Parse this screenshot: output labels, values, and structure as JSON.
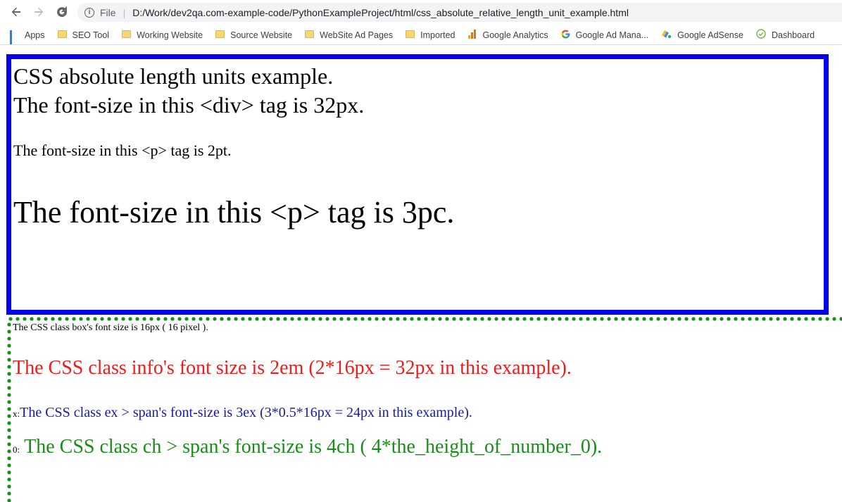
{
  "browser": {
    "url_scheme": "File",
    "url": "D:/Work/dev2qa.com-example-code/PythonExampleProject/html/css_absolute_relative_length_unit_example.html",
    "info_icon": "i"
  },
  "bookmarks": [
    {
      "label": "Apps",
      "icon": "apps-grid-icon"
    },
    {
      "label": "SEO Tool",
      "icon": "folder-icon"
    },
    {
      "label": "Working Website",
      "icon": "folder-icon"
    },
    {
      "label": "Source Website",
      "icon": "folder-icon"
    },
    {
      "label": "WebSite Ad Pages",
      "icon": "folder-icon"
    },
    {
      "label": "Imported",
      "icon": "folder-icon"
    },
    {
      "label": "Google Analytics",
      "icon": "analytics-icon"
    },
    {
      "label": "Google Ad Mana...",
      "icon": "google-g-icon"
    },
    {
      "label": "Google AdSense",
      "icon": "adsense-icon"
    },
    {
      "label": "Dashboard",
      "icon": "dashboard-icon"
    }
  ],
  "page": {
    "box_line1": "CSS absolute length units example.",
    "box_line2": "The font-size in this <div> tag is 32px.",
    "box_line3": "The font-size in this <p> tag is 2pt.",
    "box_line4": "The font-size in this <p> tag is 3pc.",
    "class_box": "The CSS class box's font size is 16px ( 16 pixel ).",
    "class_info": "The CSS class info's font size is 2em (2*16px = 32px in this example).",
    "ex_prefix": "x:",
    "class_ex": "The CSS class ex > span's font-size is 3ex (3*0.5*16px = 24px in this example).",
    "ch_prefix": "0:",
    "class_ch": "The CSS class ch > span's font-size is 4ch ( 4*the_height_of_number_0)."
  },
  "colors": {
    "box_border": "#0000ee",
    "dotted_border": "#1a8c1a",
    "info_text": "#ee1c1c",
    "ex_text": "#1a1aa6",
    "ch_text": "#1a8c1a"
  }
}
